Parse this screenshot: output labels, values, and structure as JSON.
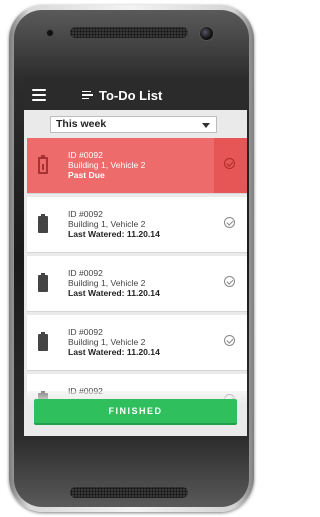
{
  "app": {
    "title": "To-Do List"
  },
  "filter": {
    "selected": "This week"
  },
  "tasks": [
    {
      "id": "ID #0092",
      "location": "Building 1, Vehicle 2",
      "status": "Past Due",
      "past_due": true
    },
    {
      "id": "ID #0092",
      "location": "Building 1, Vehicle 2",
      "status": "Last Watered: 11.20.14",
      "past_due": false
    },
    {
      "id": "ID #0092",
      "location": "Building 1, Vehicle 2",
      "status": "Last Watered: 11.20.14",
      "past_due": false
    },
    {
      "id": "ID #0092",
      "location": "Building 1, Vehicle 2",
      "status": "Last Watered: 11.20.14",
      "past_due": false
    },
    {
      "id": "ID #0092",
      "location": "",
      "status": "",
      "past_due": false
    }
  ],
  "footer": {
    "finish_label": "FINISHED"
  },
  "colors": {
    "accent_green": "#2fbf5c",
    "past_due_red": "#ee6b6b",
    "appbar": "#2b2b2b"
  },
  "icons": [
    "menu-icon",
    "list-icon",
    "chevron-down-icon",
    "battery-icon",
    "check-circle-icon"
  ]
}
